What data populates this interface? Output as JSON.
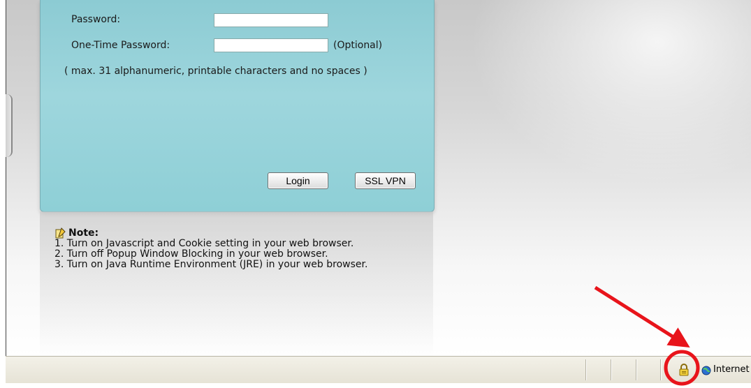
{
  "login": {
    "password_label": "Password:",
    "password_value": "",
    "otp_label": "One-Time Password:",
    "otp_value": "",
    "optional_label": "(Optional)",
    "hint": "( max. 31 alphanumeric, printable characters and no spaces )",
    "login_button": "Login",
    "ssl_vpn_button": "SSL VPN"
  },
  "note": {
    "title": "Note:",
    "icon": "note-pencil-icon",
    "items": [
      "1. Turn on Javascript and Cookie setting in your web browser.",
      "2. Turn off Popup Window Blocking in your web browser.",
      "3. Turn on Java Runtime Environment (JRE) in your web browser."
    ]
  },
  "statusbar": {
    "zone_label": "Internet",
    "lock_icon": "padlock-icon",
    "zone_icon": "globe-icon"
  },
  "annotation": {
    "color": "#e8141b"
  }
}
